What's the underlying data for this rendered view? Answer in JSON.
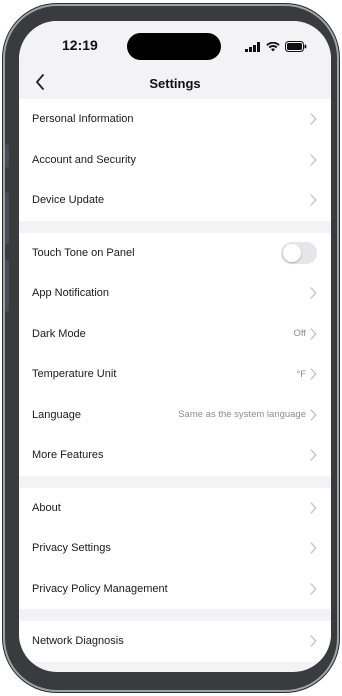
{
  "status_bar": {
    "time": "12:19"
  },
  "nav": {
    "title": "Settings"
  },
  "groups": [
    [
      {
        "label": "Personal Information"
      },
      {
        "label": "Account and Security"
      },
      {
        "label": "Device Update"
      }
    ],
    [
      {
        "label": "Touch Tone on Panel",
        "toggle_on": false
      },
      {
        "label": "App Notification"
      },
      {
        "label": "Dark Mode",
        "value": "Off"
      },
      {
        "label": "Temperature Unit",
        "value": "°F"
      },
      {
        "label": "Language",
        "value": "Same as the system language"
      },
      {
        "label": "More Features"
      }
    ],
    [
      {
        "label": "About"
      },
      {
        "label": "Privacy Settings"
      },
      {
        "label": "Privacy Policy Management"
      }
    ],
    [
      {
        "label": "Network Diagnosis"
      }
    ]
  ],
  "colors": {
    "background": "#f3f3f5",
    "chevron": "#c7c7cc",
    "toggle_off": "#e5e5ea"
  }
}
